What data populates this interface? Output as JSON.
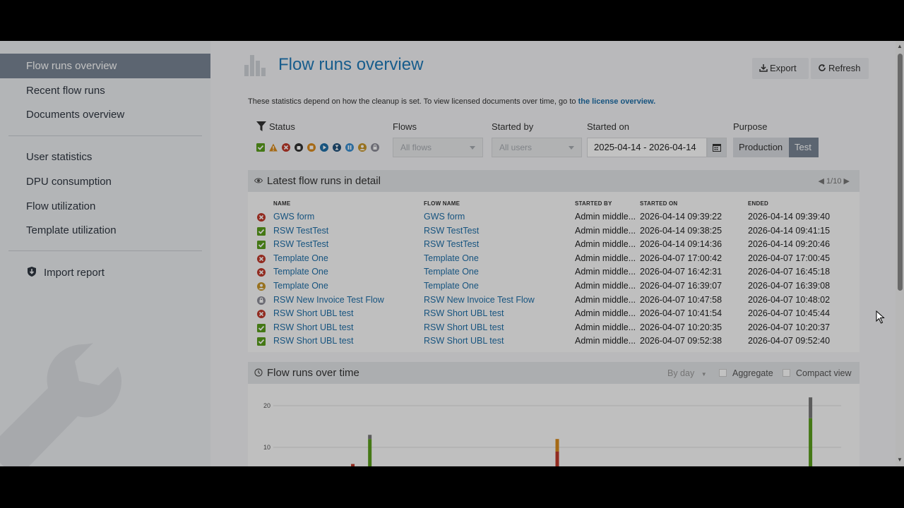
{
  "sidebar": {
    "items": [
      {
        "label": "Flow runs overview",
        "active": true
      },
      {
        "label": "Recent flow runs"
      },
      {
        "label": "Documents overview"
      },
      {
        "label": "User statistics"
      },
      {
        "label": "DPU consumption"
      },
      {
        "label": "Flow utilization"
      },
      {
        "label": "Template utilization"
      },
      {
        "label": "Import report",
        "icon": "shield-download-icon"
      }
    ]
  },
  "header": {
    "title": "Flow runs overview",
    "export_label": "Export",
    "refresh_label": "Refresh"
  },
  "note": {
    "text": "These statistics depend on how the cleanup is set. To view licensed documents over time, go to",
    "link": "the license overview."
  },
  "filters": {
    "status_label": "Status",
    "flows_label": "Flows",
    "flows_placeholder": "All flows",
    "started_by_label": "Started by",
    "started_by_placeholder": "All users",
    "started_on_label": "Started on",
    "date_range": "2025-04-14 - 2026-04-14",
    "purpose_label": "Purpose",
    "purpose_options": [
      "Production",
      "Test"
    ],
    "purpose_selected": "Test",
    "status_icons": [
      "success-check-icon",
      "warning-icon",
      "error-icon",
      "stop-hand-icon",
      "stopped-square-icon",
      "running-play-icon",
      "waiting-hourglass-icon",
      "paused-icon",
      "user-action-icon",
      "queued-icon"
    ]
  },
  "colors": {
    "accent": "#1f7ab8",
    "success": "#5a9e1c",
    "error": "#c0392b",
    "warning": "#d98a1c",
    "user": "#c8962a",
    "queued": "#8e8e99",
    "active_nav": "#7a8595"
  },
  "latest": {
    "title": "Latest flow runs in detail",
    "pager": "1/10",
    "columns": [
      "NAME",
      "FLOW NAME",
      "STARTED BY",
      "STARTED ON",
      "ENDED"
    ],
    "rows": [
      {
        "status": "error",
        "name": "GWS form",
        "flow": "GWS form",
        "by": "Admin middle...",
        "started": "2026-04-14 09:39:22",
        "ended": "2026-04-14 09:39:40"
      },
      {
        "status": "success",
        "name": "RSW TestTest",
        "flow": "RSW TestTest",
        "by": "Admin middle...",
        "started": "2026-04-14 09:38:25",
        "ended": "2026-04-14 09:41:15"
      },
      {
        "status": "success",
        "name": "RSW TestTest",
        "flow": "RSW TestTest",
        "by": "Admin middle...",
        "started": "2026-04-14 09:14:36",
        "ended": "2026-04-14 09:20:46"
      },
      {
        "status": "error",
        "name": "Template One",
        "flow": "Template One",
        "by": "Admin middle...",
        "started": "2026-04-07 17:00:42",
        "ended": "2026-04-07 17:00:45"
      },
      {
        "status": "error",
        "name": "Template One",
        "flow": "Template One",
        "by": "Admin middle...",
        "started": "2026-04-07 16:42:31",
        "ended": "2026-04-07 16:45:18"
      },
      {
        "status": "user",
        "name": "Template One",
        "flow": "Template One",
        "by": "Admin middle...",
        "started": "2026-04-07 16:39:07",
        "ended": "2026-04-07 16:39:08"
      },
      {
        "status": "queued",
        "name": "RSW New Invoice Test Flow",
        "flow": "RSW New Invoice Test Flow",
        "by": "Admin middle...",
        "started": "2026-04-07 10:47:58",
        "ended": "2026-04-07 10:48:02"
      },
      {
        "status": "error",
        "name": "RSW Short UBL test",
        "flow": "RSW Short UBL test",
        "by": "Admin middle...",
        "started": "2026-04-07 10:41:54",
        "ended": "2026-04-07 10:45:44"
      },
      {
        "status": "success",
        "name": "RSW Short UBL test",
        "flow": "RSW Short UBL test",
        "by": "Admin middle...",
        "started": "2026-04-07 10:20:35",
        "ended": "2026-04-07 10:20:37"
      },
      {
        "status": "success",
        "name": "RSW Short UBL test",
        "flow": "RSW Short UBL test",
        "by": "Admin middle...",
        "started": "2026-04-07 09:52:38",
        "ended": "2026-04-07 09:52:40"
      }
    ]
  },
  "over_time": {
    "title": "Flow runs over time",
    "interval": "By day",
    "aggregate_label": "Aggregate",
    "compact_label": "Compact view",
    "chart_data": {
      "type": "bar",
      "stacked": true,
      "ylim": [
        0,
        20
      ],
      "yticks": [
        10,
        20
      ],
      "grid": true,
      "bars": [
        {
          "pos": 0.066,
          "success": 3,
          "error": 0,
          "other": 0
        },
        {
          "pos": 0.14,
          "success": 2,
          "error": 4,
          "other": 0
        },
        {
          "pos": 0.17,
          "success": 12,
          "error": 0,
          "other": 1
        },
        {
          "pos": 0.5,
          "success": 0,
          "error": 9,
          "other": 3
        },
        {
          "pos": 0.946,
          "success": 17,
          "error": 0,
          "other": 5
        }
      ]
    }
  }
}
